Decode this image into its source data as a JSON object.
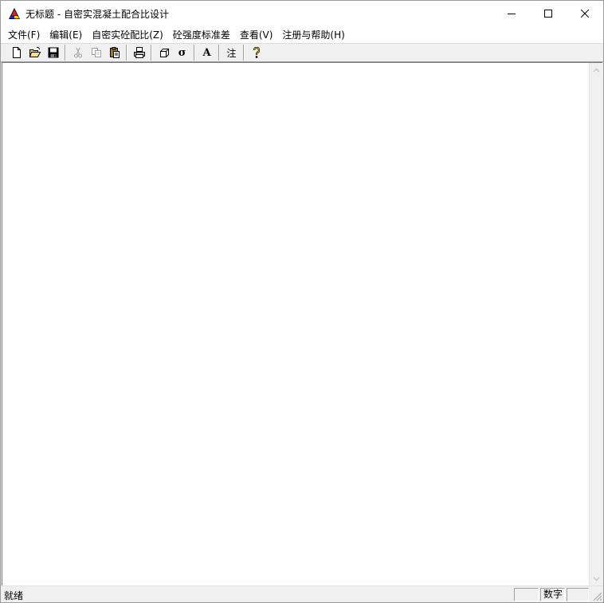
{
  "window": {
    "title": "无标题 - 自密实混凝土配合比设计"
  },
  "menu": {
    "items": [
      {
        "label": "文件(F)"
      },
      {
        "label": "编辑(E)"
      },
      {
        "label": "自密实砼配比(Z)"
      },
      {
        "label": "砼强度标准差"
      },
      {
        "label": "查看(V)"
      },
      {
        "label": "注册与帮助(H)"
      }
    ]
  },
  "toolbar": {
    "font_label": "A",
    "note_label": "注",
    "sigma_label": "σ",
    "icons": [
      "new-file-icon",
      "open-folder-icon",
      "save-icon",
      "cut-icon",
      "copy-icon",
      "paste-icon",
      "print-icon",
      "box-icon",
      "sigma-icon",
      "font-icon",
      "note-icon",
      "help-icon"
    ]
  },
  "status": {
    "text": "就绪",
    "pane_num": "数字"
  },
  "colors": {
    "icon_red": "#e02020",
    "icon_yellow": "#f0d000",
    "icon_blue": "#1030c0"
  }
}
